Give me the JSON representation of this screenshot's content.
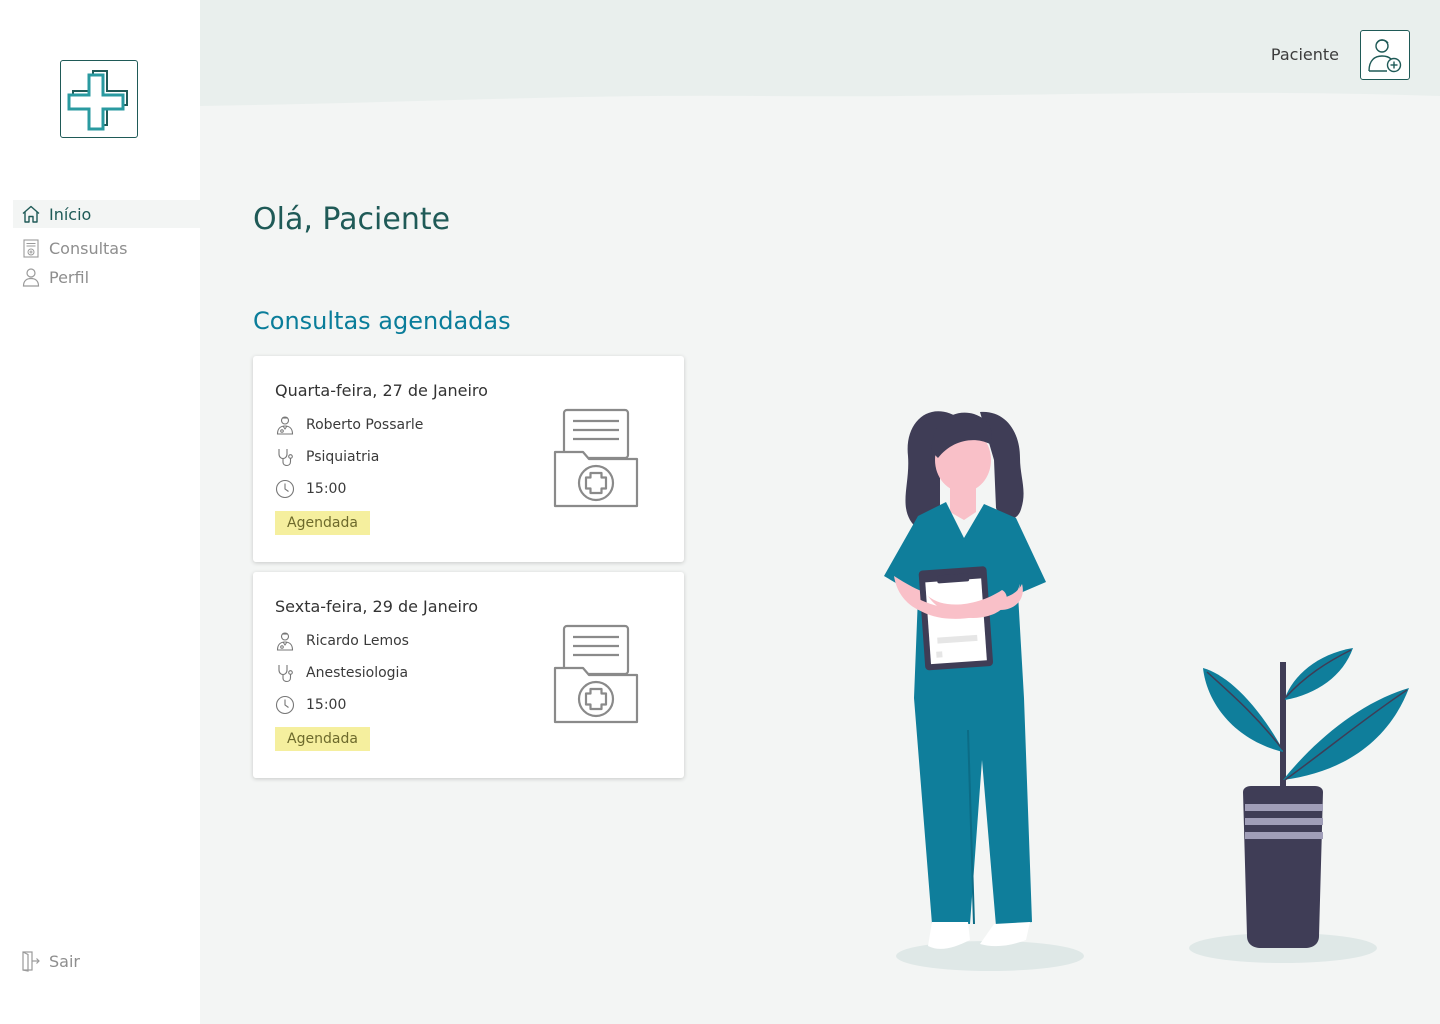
{
  "app": {
    "brand_icon": "medical-cross-icon"
  },
  "sidebar": {
    "items": [
      {
        "label": "Início",
        "icon": "home-icon",
        "active": true
      },
      {
        "label": "Consultas",
        "icon": "calendar-icon",
        "active": false
      },
      {
        "label": "Perfil",
        "icon": "user-icon",
        "active": false
      }
    ],
    "logout": {
      "label": "Sair",
      "icon": "logout-icon"
    }
  },
  "header": {
    "user_label": "Paciente",
    "avatar_icon": "patient-avatar-icon"
  },
  "main": {
    "greeting": "Olá, Paciente",
    "section_title": "Consultas agendadas",
    "appointments": [
      {
        "date": "Quarta-feira, 27 de Janeiro",
        "doctor": "Roberto Possarle",
        "specialty": "Psiquiatria",
        "time": "15:00",
        "status": "Agendada"
      },
      {
        "date": "Sexta-feira, 29 de Janeiro",
        "doctor": "Ricardo Lemos",
        "specialty": "Anestesiologia",
        "time": "15:00",
        "status": "Agendada"
      }
    ]
  },
  "colors": {
    "brand_dark": "#1f5a57",
    "accent_blue": "#0a7d9a",
    "badge_bg": "#f5ef9e",
    "scrub_teal": "#0f7e9b",
    "background": "#f3f5f4"
  }
}
